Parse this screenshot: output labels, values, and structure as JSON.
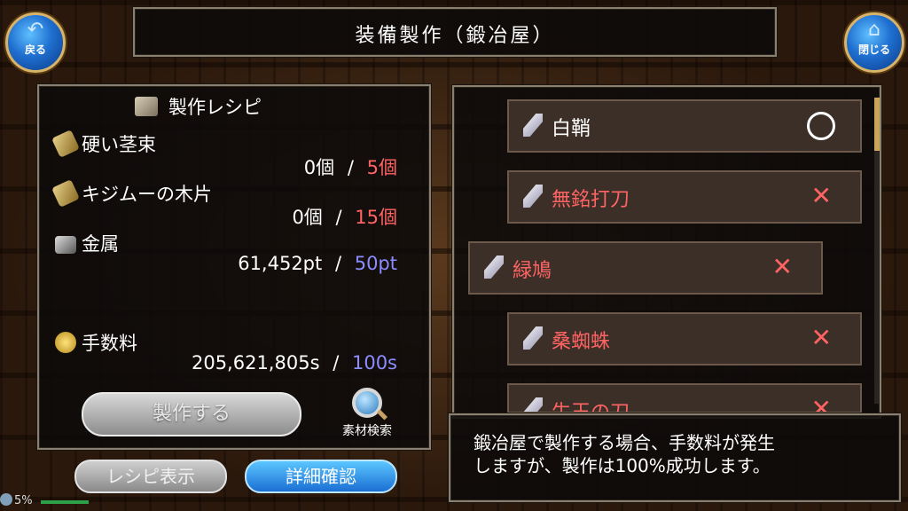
{
  "window": {
    "title": "装備製作（鍛冶屋）"
  },
  "buttons": {
    "back_label": "戻る",
    "close_label": "閉じる",
    "back_icon": "back-arrow-icon",
    "close_icon": "home-icon"
  },
  "recipe": {
    "header": "製作レシピ",
    "materials": [
      {
        "name": "硬い茎束",
        "have": "0個",
        "sep": "/",
        "need": "5個",
        "need_color": "#ff6464"
      },
      {
        "name": "キジムーの木片",
        "have": "0個",
        "sep": "/",
        "need": "15個",
        "need_color": "#ff6464"
      },
      {
        "name": "金属",
        "have": "61,452pt",
        "sep": "/",
        "need": "50pt",
        "need_color": "#8a8cff"
      },
      {
        "name": "手数料",
        "have": "205,621,805s",
        "sep": "/",
        "need": "100s",
        "need_color": "#8a8cff"
      }
    ],
    "craft_label": "製作する",
    "search_label": "素材検索"
  },
  "bottom_buttons": {
    "recipe_view": "レシピ表示",
    "detail_check": "詳細確認"
  },
  "item_list": [
    {
      "name": "白鞘",
      "status": "○",
      "name_color": "#ffffff"
    },
    {
      "name": "無銘打刀",
      "status": "✕",
      "name_color": "#ff6464"
    },
    {
      "name": "緑鳩",
      "status": "✕",
      "name_color": "#ff6464"
    },
    {
      "name": "桑蜘蛛",
      "status": "✕",
      "name_color": "#ff6464"
    },
    {
      "name": "生王の刀",
      "status": "✕",
      "name_color": "#ff6464"
    }
  ],
  "message": {
    "line1": "鍛冶屋で製作する場合、手数料が発生",
    "line2": "しますが、製作は100%成功します。"
  },
  "status_bar": {
    "battery": "5%"
  }
}
